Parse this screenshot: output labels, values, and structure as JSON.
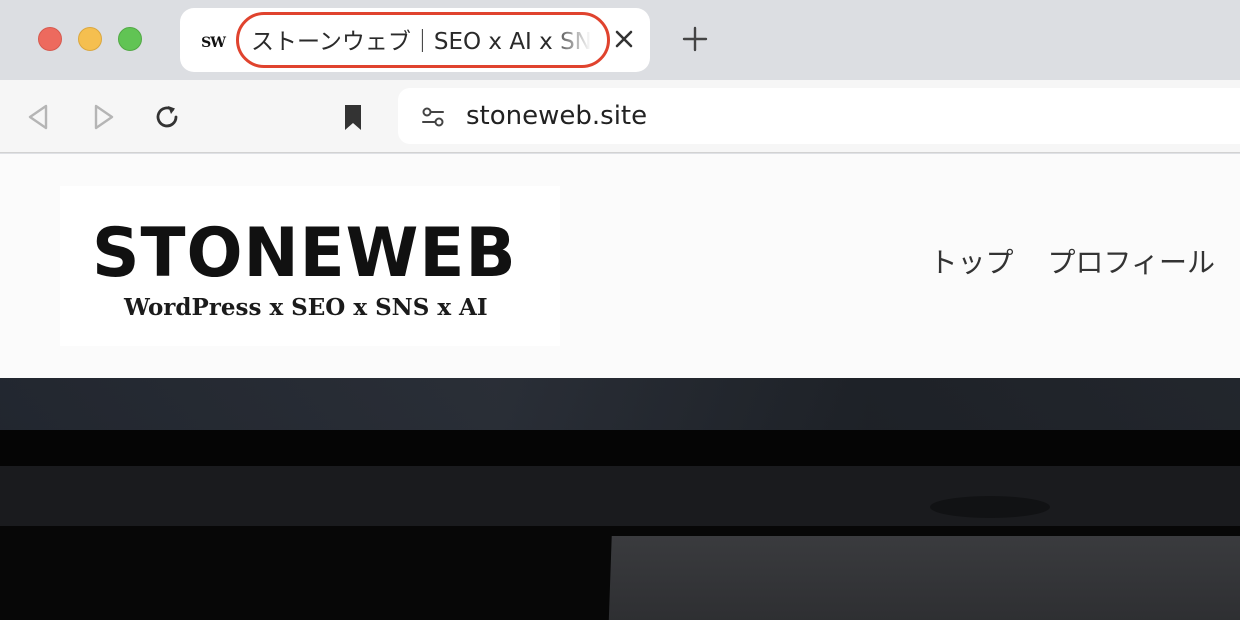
{
  "browser": {
    "tab": {
      "favicon_text": "SW",
      "title": "ストーンウェブ｜SEO x AI x SNS"
    },
    "address_bar": {
      "url": "stoneweb.site"
    },
    "icons": {
      "tab_close": "close-icon",
      "new_tab": "plus-icon",
      "back": "back-arrow-icon",
      "forward": "forward-arrow-icon",
      "reload": "reload-icon",
      "bookmark": "bookmark-icon",
      "site_settings": "sliders-icon"
    },
    "colors": {
      "highlight": "#e0432e",
      "traffic_close": "#ed6a5e",
      "traffic_minimize": "#f5bf4f",
      "traffic_maximize": "#61c454"
    }
  },
  "site": {
    "logo": {
      "main": "STONEWEB",
      "tagline": "WordPress x SEO x SNS x AI"
    },
    "nav": [
      {
        "label": "トップ"
      },
      {
        "label": "プロフィール"
      }
    ]
  }
}
